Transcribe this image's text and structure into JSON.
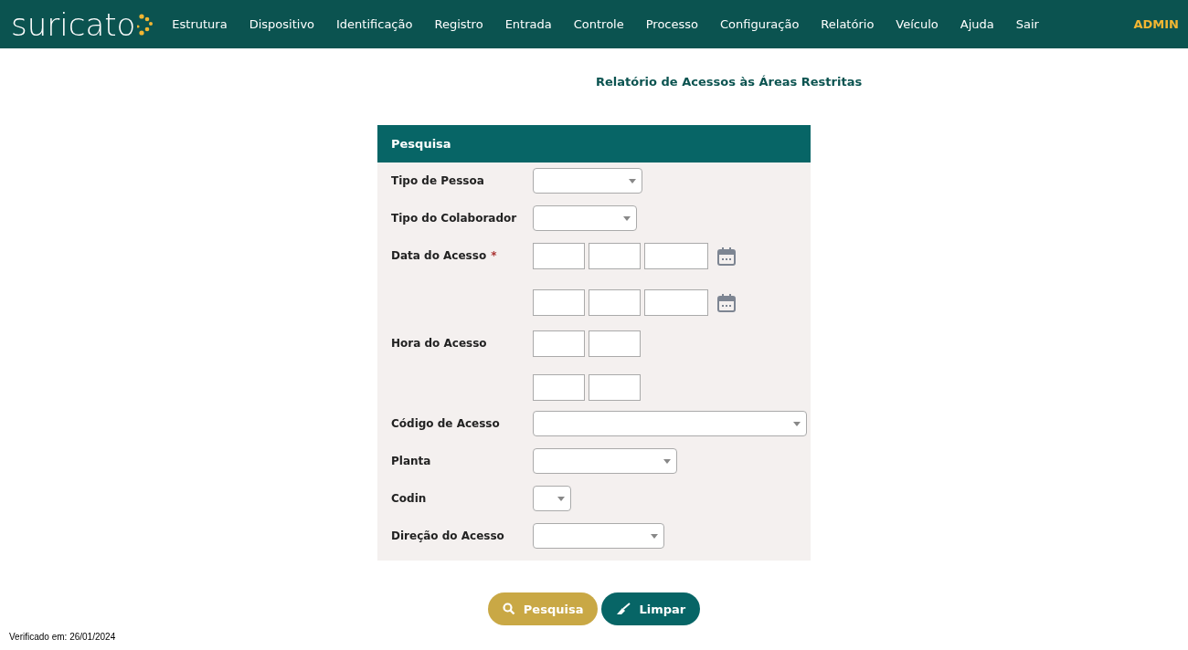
{
  "brand": "suricato",
  "nav": [
    "Estrutura",
    "Dispositivo",
    "Identificação",
    "Registro",
    "Entrada",
    "Controle",
    "Processo",
    "Configuração",
    "Relatório",
    "Veículo",
    "Ajuda",
    "Sair"
  ],
  "user": "ADMIN",
  "page_title": "Relatório de Acessos às Áreas Restritas",
  "panel": {
    "title": "Pesquisa",
    "fields": [
      {
        "kind": "select",
        "label": "Tipo de Pessoa"
      },
      {
        "kind": "select",
        "label": "Tipo do Colaborador"
      },
      {
        "kind": "date",
        "label": "Data do Acesso",
        "mark": "*"
      },
      {
        "kind": "time",
        "label": "Hora do Acesso"
      },
      {
        "kind": "select",
        "label": "Código de Acesso"
      },
      {
        "kind": "select",
        "label": "Planta"
      },
      {
        "kind": "select",
        "label": "Codin"
      },
      {
        "kind": "select",
        "label": "Direção do Acesso"
      }
    ]
  },
  "buttons": [
    {
      "kind": "search",
      "label": "Pesquisa"
    },
    {
      "kind": "clear",
      "label": "Limpar"
    }
  ],
  "footer": "Verificado em: 26/01/2024"
}
